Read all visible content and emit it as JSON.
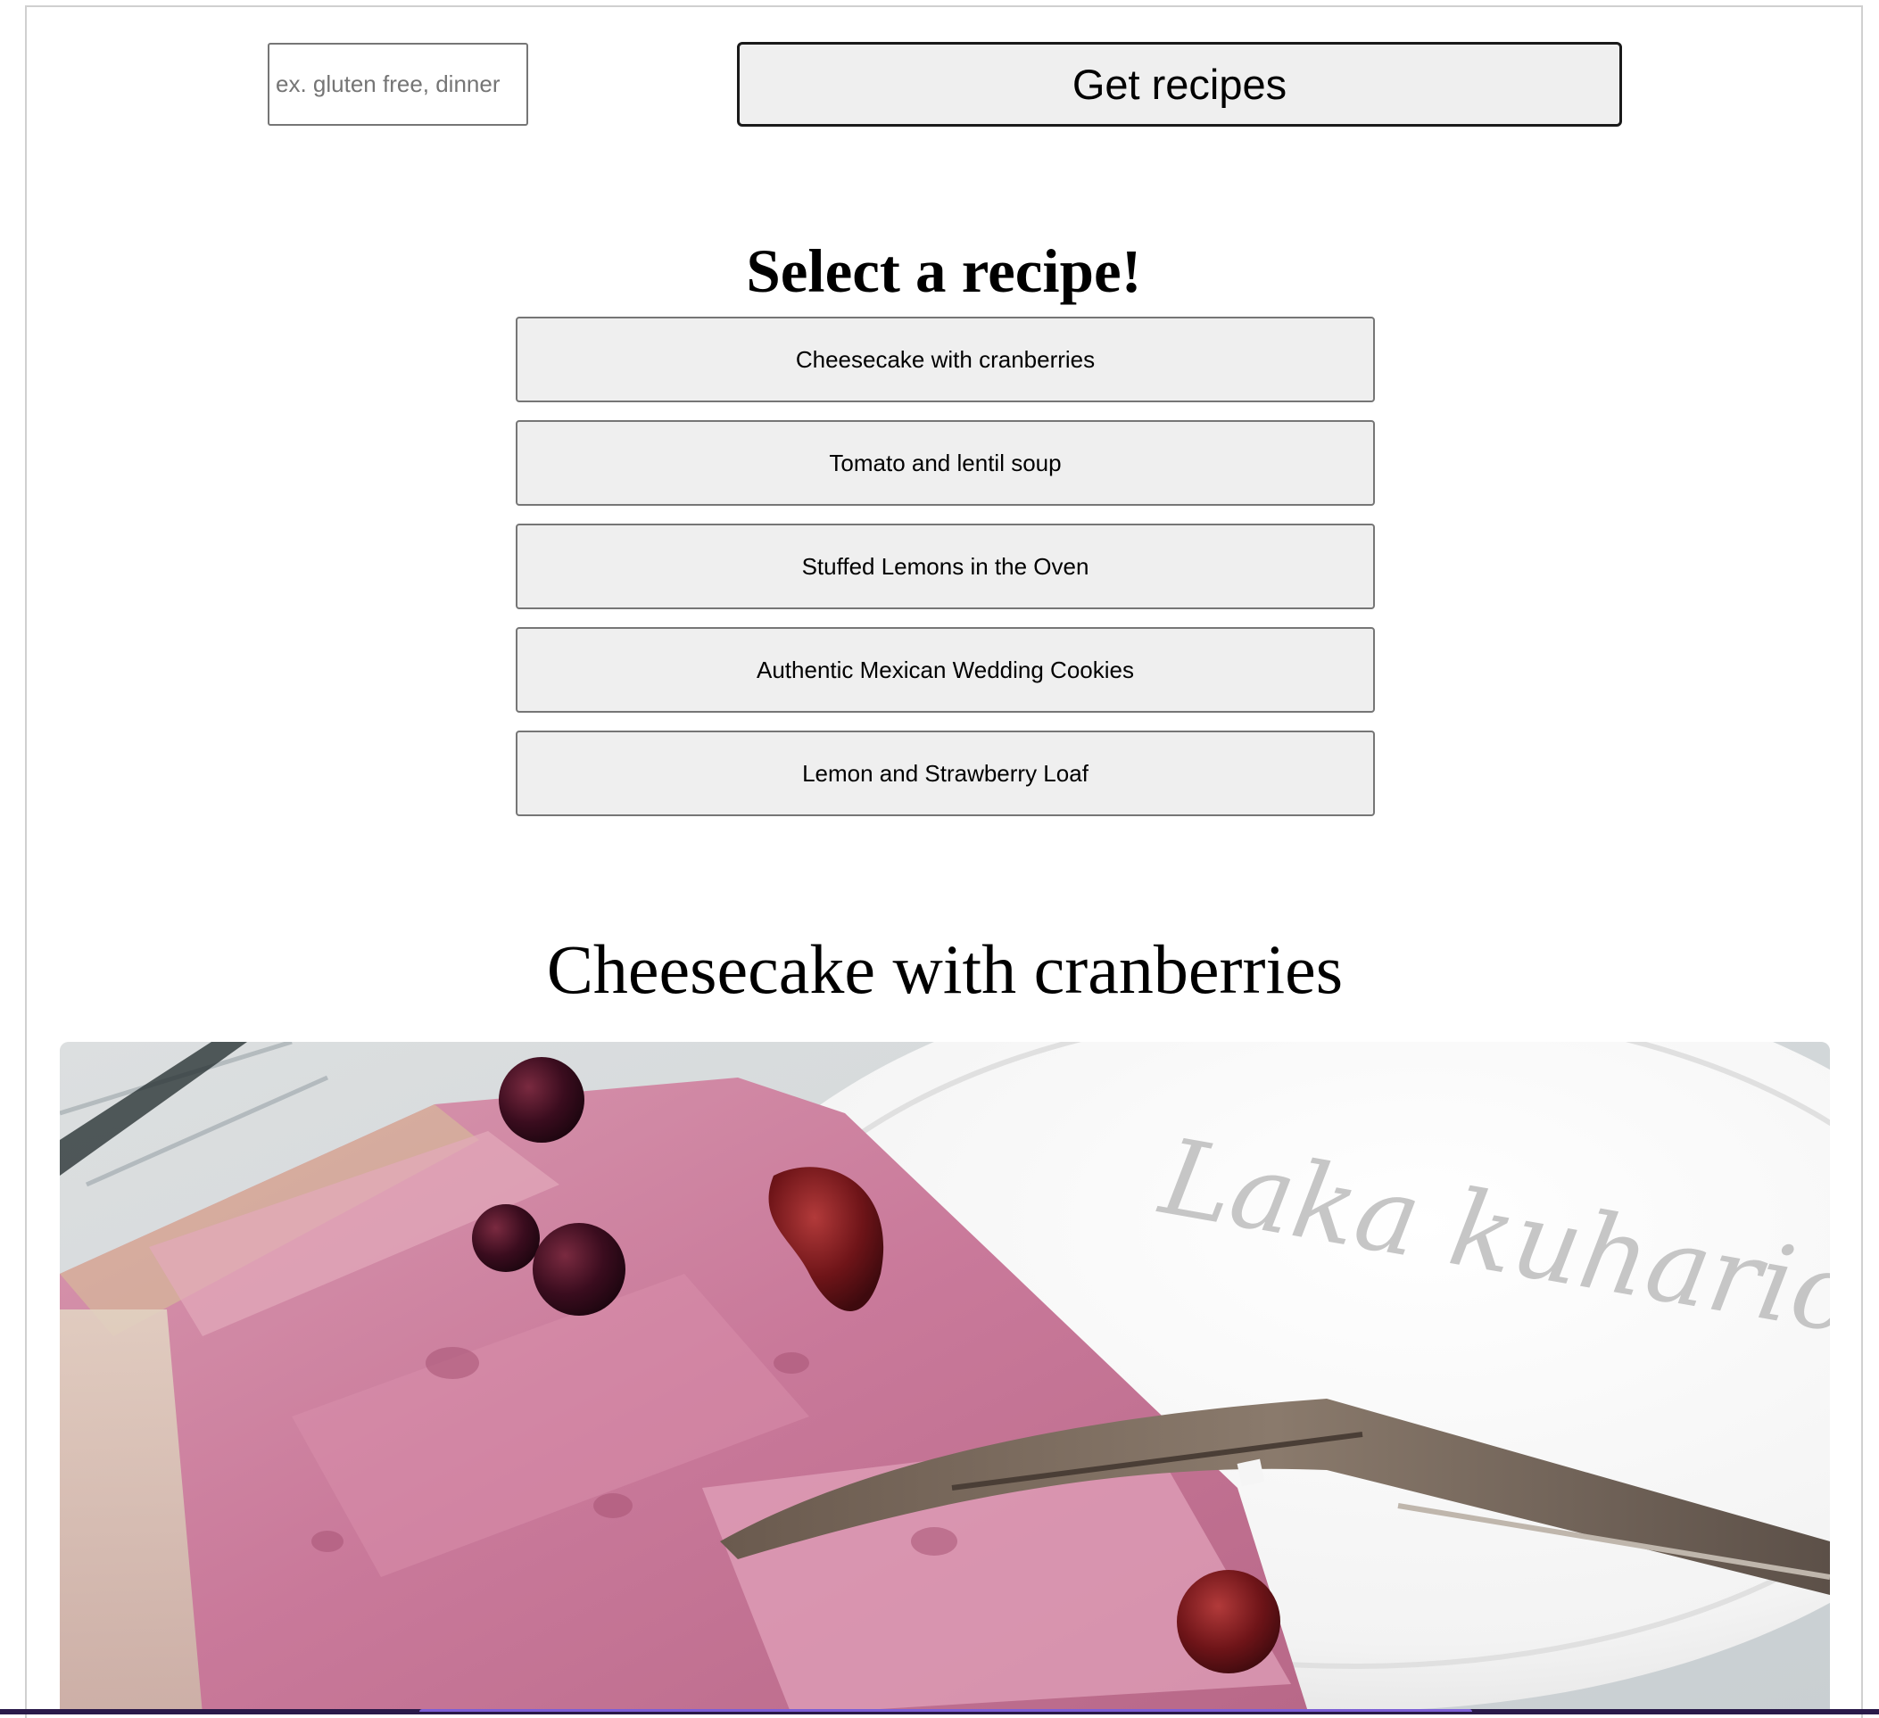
{
  "search": {
    "value": "",
    "placeholder": "ex. gluten free, dinner"
  },
  "get_button_label": "Get recipes",
  "select_heading": "Select a recipe!",
  "recipes": [
    {
      "label": "Cheesecake with cranberries"
    },
    {
      "label": "Tomato and lentil soup"
    },
    {
      "label": "Stuffed Lemons in the Oven"
    },
    {
      "label": "Authentic Mexican Wedding Cookies"
    },
    {
      "label": "Lemon and Strawberry Loaf"
    }
  ],
  "selected_recipe": {
    "title": "Cheesecake with cranberries",
    "image_watermark": "Laka kuharica"
  },
  "colors": {
    "button_bg": "#efefef",
    "border": "#767676",
    "cake": "#c9799a",
    "cranberry": "#5a1420"
  }
}
